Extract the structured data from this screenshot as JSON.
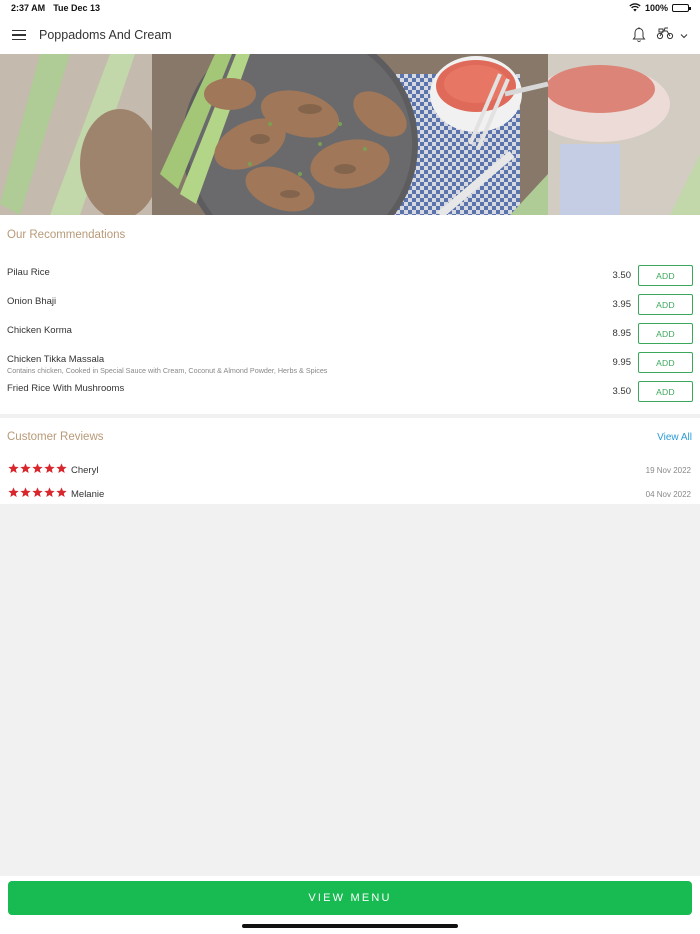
{
  "status_bar": {
    "time": "2:37 AM",
    "date": "Tue Dec 13",
    "battery": "100%",
    "battery_level": 1.0
  },
  "header": {
    "title": "Poppadoms And Cream",
    "menu_icon": "hamburger-menu-icon",
    "notification_icon": "bell-icon",
    "delivery_icon": "scooter-icon",
    "dropdown_icon": "chevron-down-icon"
  },
  "banner": {
    "image": "grilled-chicken-wings-banner"
  },
  "recommendations": {
    "title": "Our Recommendations",
    "add_label": "ADD",
    "items": [
      {
        "name": "Pilau Rice",
        "description": "",
        "price": "3.50"
      },
      {
        "name": "Onion Bhaji",
        "description": "",
        "price": "3.95"
      },
      {
        "name": "Chicken Korma",
        "description": "",
        "price": "8.95"
      },
      {
        "name": "Chicken Tikka Massala",
        "description": "Contains chicken, Cooked in Special Sauce with Cream, Coconut & Almond Powder, Herbs & Spices",
        "price": "9.95"
      },
      {
        "name": "Fried Rice With Mushrooms",
        "description": "",
        "price": "3.50"
      }
    ]
  },
  "reviews": {
    "title": "Customer Reviews",
    "view_all": "View All",
    "items": [
      {
        "name": "Cheryl",
        "date": "19 Nov 2022",
        "rating": 5
      },
      {
        "name": "Melanie",
        "date": "04 Nov 2022",
        "rating": 5
      }
    ]
  },
  "footer": {
    "view_menu": "VIEW MENU"
  },
  "colors": {
    "accent_green": "#17bb52",
    "add_green": "#3aa75b",
    "section_title": "#b89a78",
    "link_blue": "#2b9bd7",
    "star_red": "#d9262c"
  }
}
